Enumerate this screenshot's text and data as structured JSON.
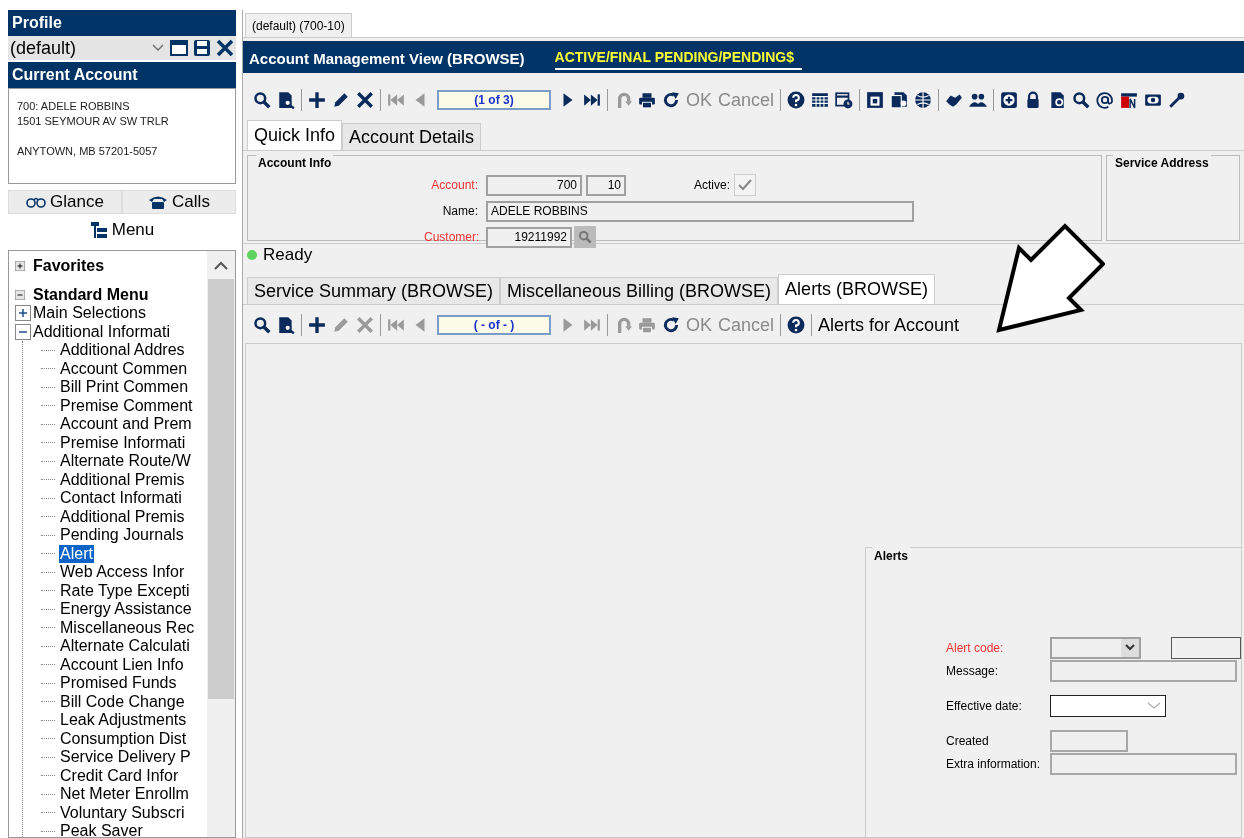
{
  "sidebar": {
    "profile": {
      "title": "Profile",
      "value": "(default)"
    },
    "current_account": {
      "title": "Current Account",
      "blocks": [
        [
          "700: ADELE ROBBINS",
          "1501 SEYMOUR AV SW TRLR"
        ],
        [
          "ANYTOWN, MB 57201-5057"
        ]
      ]
    },
    "buttons": [
      {
        "kind": "glance",
        "label": "Glance"
      },
      {
        "kind": "calls",
        "label": "Calls"
      }
    ],
    "menu_button": "Menu",
    "tree": [
      {
        "kind": "section",
        "label": "Favorites",
        "expanded": false
      },
      {
        "kind": "section",
        "label": "Standard Menu",
        "expanded": true,
        "children": [
          {
            "kind": "folder",
            "label": "Main Selections",
            "expanded": false
          },
          {
            "kind": "folder",
            "label": "Additional Informati",
            "expanded": true,
            "children": [
              {
                "kind": "leaf",
                "label": "Additional Addres",
                "selected": false
              },
              {
                "kind": "leaf",
                "label": "Account Commen",
                "selected": false
              },
              {
                "kind": "leaf",
                "label": "Bill Print Commen",
                "selected": false
              },
              {
                "kind": "leaf",
                "label": "Premise Comment",
                "selected": false
              },
              {
                "kind": "leaf",
                "label": "Account and Prem",
                "selected": false
              },
              {
                "kind": "leaf",
                "label": "Premise Informati",
                "selected": false
              },
              {
                "kind": "leaf",
                "label": "Alternate Route/W",
                "selected": false
              },
              {
                "kind": "leaf",
                "label": "Additional Premis",
                "selected": false
              },
              {
                "kind": "leaf",
                "label": "Contact Informati",
                "selected": false
              },
              {
                "kind": "leaf",
                "label": "Additional Premis",
                "selected": false
              },
              {
                "kind": "leaf",
                "label": "Pending Journals",
                "selected": false
              },
              {
                "kind": "leaf",
                "label": "Alert",
                "selected": true
              },
              {
                "kind": "leaf",
                "label": "Web Access Infor",
                "selected": false
              },
              {
                "kind": "leaf",
                "label": "Rate Type Excepti",
                "selected": false
              },
              {
                "kind": "leaf",
                "label": "Energy Assistance",
                "selected": false
              },
              {
                "kind": "leaf",
                "label": "Miscellaneous Rec",
                "selected": false
              },
              {
                "kind": "leaf",
                "label": "Alternate Calculati",
                "selected": false
              },
              {
                "kind": "leaf",
                "label": "Account Lien Info",
                "selected": false
              },
              {
                "kind": "leaf",
                "label": "Promised Funds",
                "selected": false
              },
              {
                "kind": "leaf",
                "label": "Bill Code Change",
                "selected": false
              },
              {
                "kind": "leaf",
                "label": "Leak Adjustments",
                "selected": false
              },
              {
                "kind": "leaf",
                "label": "Consumption Dist",
                "selected": false
              },
              {
                "kind": "leaf",
                "label": "Service Delivery P",
                "selected": false
              },
              {
                "kind": "leaf",
                "label": "Credit Card Infor",
                "selected": false
              },
              {
                "kind": "leaf",
                "label": "Net Meter Enrollm",
                "selected": false
              },
              {
                "kind": "leaf",
                "label": "Voluntary Subscri",
                "selected": false
              },
              {
                "kind": "leaf",
                "label": "Peak Saver",
                "selected": false
              }
            ]
          }
        ]
      }
    ]
  },
  "document_tab": "(default) (700-10)",
  "header": {
    "title": "Account Management View (BROWSE)",
    "status": "ACTIVE/FINAL PENDING/PENDING$"
  },
  "toolbar": [
    {
      "kind": "search",
      "disabled": false
    },
    {
      "kind": "preview",
      "disabled": false
    },
    {
      "kind": "sep"
    },
    {
      "kind": "add",
      "disabled": false
    },
    {
      "kind": "edit",
      "disabled": false
    },
    {
      "kind": "delete",
      "disabled": false
    },
    {
      "kind": "sep"
    },
    {
      "kind": "first",
      "disabled": true
    },
    {
      "kind": "prev",
      "disabled": true
    },
    {
      "kind": "pager",
      "text": "(1 of 3)"
    },
    {
      "kind": "next",
      "disabled": false
    },
    {
      "kind": "last",
      "disabled": false
    },
    {
      "kind": "sep"
    },
    {
      "kind": "undo",
      "disabled": true
    },
    {
      "kind": "print",
      "disabled": false
    },
    {
      "kind": "refresh",
      "disabled": false
    },
    {
      "kind": "text",
      "label": "OK",
      "disabled": true
    },
    {
      "kind": "text",
      "label": "Cancel",
      "disabled": true
    },
    {
      "kind": "sep"
    },
    {
      "kind": "help",
      "disabled": false
    },
    {
      "kind": "grid",
      "disabled": false
    },
    {
      "kind": "calendar",
      "disabled": false
    },
    {
      "kind": "sep"
    },
    {
      "kind": "edoc",
      "disabled": false
    },
    {
      "kind": "docs",
      "disabled": false
    },
    {
      "kind": "globe",
      "disabled": false
    },
    {
      "kind": "sep"
    },
    {
      "kind": "hand",
      "disabled": false
    },
    {
      "kind": "people",
      "disabled": false
    },
    {
      "kind": "sep"
    },
    {
      "kind": "plusbox",
      "disabled": false
    },
    {
      "kind": "lock",
      "disabled": false
    },
    {
      "kind": "moneydoc",
      "disabled": false
    },
    {
      "kind": "search",
      "disabled": false
    },
    {
      "kind": "at",
      "disabled": false
    },
    {
      "kind": "flag",
      "disabled": false
    },
    {
      "kind": "money",
      "disabled": false
    },
    {
      "kind": "wrench",
      "disabled": false
    }
  ],
  "tabs": [
    {
      "label": "Quick Info",
      "selected": true
    },
    {
      "label": "Account Details",
      "selected": false
    }
  ],
  "account_info": {
    "title": "Account Info",
    "fields": [
      {
        "kind": "pair",
        "label": "Account:",
        "required": true,
        "values": [
          "700",
          "10"
        ]
      },
      {
        "kind": "wide",
        "label": "Name:",
        "required": false,
        "value": "ADELE ROBBINS"
      },
      {
        "kind": "lookup",
        "label": "Customer:",
        "required": true,
        "value": "19211992"
      }
    ],
    "active": {
      "label": "Active:",
      "checked": true
    }
  },
  "service_address": {
    "title": "Service Address"
  },
  "status": {
    "text": "Ready",
    "online": true
  },
  "lower_tabs": [
    {
      "label": "Service Summary (BROWSE)",
      "selected": false
    },
    {
      "label": "Miscellaneous Billing (BROWSE)",
      "selected": false
    },
    {
      "label": "Alerts (BROWSE)",
      "selected": true
    }
  ],
  "lower_toolbar": [
    {
      "kind": "search",
      "disabled": false
    },
    {
      "kind": "preview",
      "disabled": false
    },
    {
      "kind": "sep"
    },
    {
      "kind": "add",
      "disabled": false
    },
    {
      "kind": "edit",
      "disabled": true
    },
    {
      "kind": "delete",
      "disabled": true
    },
    {
      "kind": "sep"
    },
    {
      "kind": "first",
      "disabled": true
    },
    {
      "kind": "prev",
      "disabled": true
    },
    {
      "kind": "pager",
      "text": "( - of - )"
    },
    {
      "kind": "next",
      "disabled": true
    },
    {
      "kind": "last",
      "disabled": true
    },
    {
      "kind": "sep"
    },
    {
      "kind": "undo",
      "disabled": true
    },
    {
      "kind": "print",
      "disabled": true
    },
    {
      "kind": "refresh",
      "disabled": false
    },
    {
      "kind": "text",
      "label": "OK",
      "disabled": true
    },
    {
      "kind": "text",
      "label": "Cancel",
      "disabled": true
    },
    {
      "kind": "sep"
    },
    {
      "kind": "help",
      "disabled": false
    },
    {
      "kind": "sep"
    },
    {
      "kind": "caption",
      "label": "Alerts for Account"
    }
  ],
  "alerts_form": {
    "title": "Alerts",
    "fields": [
      {
        "kind": "combo",
        "label": "Alert code:",
        "required": true
      },
      {
        "kind": "text",
        "label": "Message:",
        "required": false
      },
      {
        "kind": "date",
        "label": "Effective date:",
        "required": false
      },
      {
        "kind": "short",
        "label": "Created",
        "required": false
      },
      {
        "kind": "text",
        "label": "Extra information:",
        "required": false
      }
    ]
  }
}
